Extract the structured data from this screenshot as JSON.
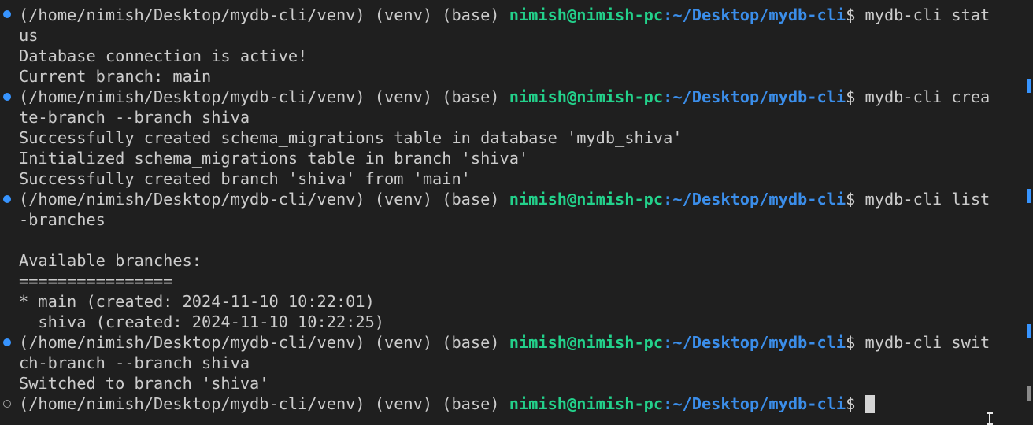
{
  "prompt": {
    "env": "(/home/nimish/Desktop/mydb-cli/venv) (venv) (base) ",
    "user_host": "nimish@nimish-pc",
    "path": ":~/Desktop/mydb-cli",
    "symbol": "$ "
  },
  "blocks": [
    {
      "status": "done",
      "command_line1": "mydb-cli stat",
      "command_wrap": "us",
      "output": [
        "Database connection is active!",
        "Current branch: main"
      ]
    },
    {
      "status": "done",
      "command_line1": "mydb-cli crea",
      "command_wrap": "te-branch --branch shiva",
      "output": [
        "Successfully created schema_migrations table in database 'mydb_shiva'",
        "Initialized schema_migrations table in branch 'shiva'",
        "Successfully created branch 'shiva' from 'main'"
      ]
    },
    {
      "status": "done",
      "command_line1": "mydb-cli list",
      "command_wrap": "-branches",
      "output": [
        "",
        "Available branches:",
        "================",
        "* main (created: 2024-11-10 10:22:01)",
        "  shiva (created: 2024-11-10 10:22:25)"
      ]
    },
    {
      "status": "done",
      "command_line1": "mydb-cli swit",
      "command_wrap": "ch-branch --branch shiva",
      "output": [
        "Switched to branch 'shiva'"
      ]
    }
  ],
  "current": {
    "status": "pending",
    "command": ""
  },
  "colors": {
    "background": "#1f1f1f",
    "foreground": "#cccccc",
    "user_host": "#23d18b",
    "path": "#3b8eea",
    "decoration_success": "#3794ff",
    "decoration_pending": "#9d9d9d"
  }
}
